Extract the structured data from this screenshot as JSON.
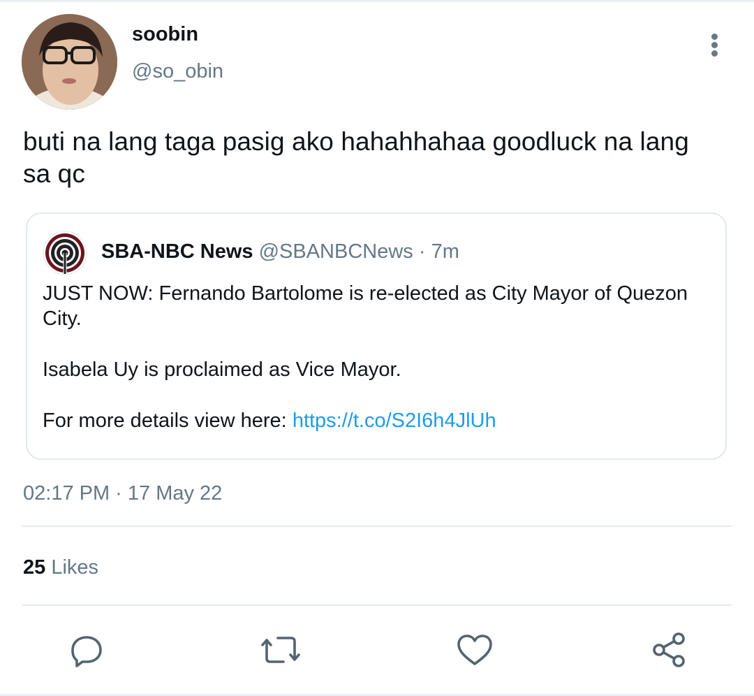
{
  "user": {
    "display_name": "soobin",
    "handle": "@so_obin"
  },
  "tweet": {
    "text": "buti na lang taga pasig ako hahahhahaa goodluck na lang sa qc",
    "timestamp": "02:17 PM · 17 May 22"
  },
  "quote": {
    "name": "SBA-NBC News",
    "meta": "@SBANBCNews · 7m",
    "paragraph1": "JUST NOW: Fernando Bartolome is re-elected as City Mayor of Quezon City.",
    "paragraph2": "Isabela Uy is proclaimed as Vice Mayor.",
    "paragraph3_prefix": "For more details view here: ",
    "link": "https://t.co/S2I6h4JlUh"
  },
  "stats": {
    "likes_count": "25",
    "likes_label": "Likes"
  },
  "icons": {
    "more": "more-vertical-icon",
    "reply": "reply-icon",
    "retweet": "retweet-icon",
    "like": "heart-icon",
    "share": "share-icon"
  },
  "colors": {
    "text": "#0f1419",
    "secondary": "#657786",
    "link": "#1d9bf0",
    "icon": "#536471",
    "border": "#e1e8ed"
  }
}
